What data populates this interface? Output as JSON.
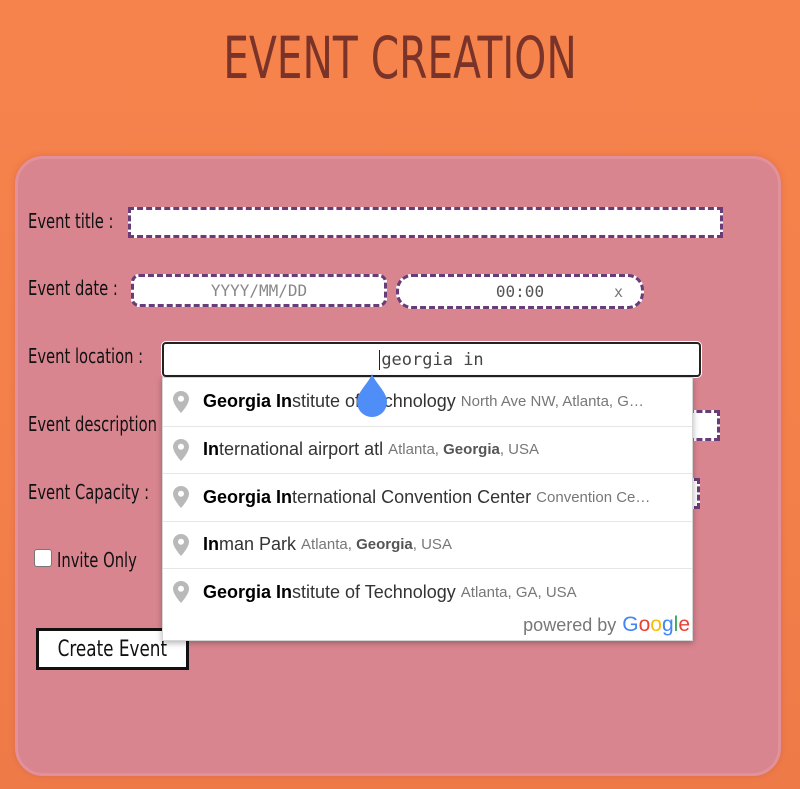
{
  "page": {
    "title": "EVENT CREATION"
  },
  "form": {
    "title_label": "Event title :",
    "title_value": "",
    "date_label": "Event date :",
    "date_placeholder": "YYYY/MM/DD",
    "time_value": "00:00",
    "time_clear": "x",
    "location_label": "Event location :",
    "location_value": "georgia in",
    "description_label": "Event description :",
    "capacity_label": "Event Capacity :",
    "invite_only_label": "Invite Only",
    "invite_only_checked": false,
    "create_button": "Create Event"
  },
  "autocomplete": {
    "items": [
      {
        "main_bold": "Georgia In",
        "main_rest": "stitute of Technology",
        "secondary": "North Ave NW, Atlanta, G…"
      },
      {
        "main_bold": "In",
        "main_rest": "ternational airport atl",
        "secondary_pre": "Atlanta, ",
        "secondary_bold": "Georgia",
        "secondary_post": ", USA"
      },
      {
        "main_bold": "Georgia In",
        "main_rest": "ternational Convention Center",
        "secondary": "Convention Ce…"
      },
      {
        "main_bold": "In",
        "main_rest": "man Park",
        "secondary_pre": "Atlanta, ",
        "secondary_bold": "Georgia",
        "secondary_post": ", USA"
      },
      {
        "main_bold": "Georgia In",
        "main_rest": "stitute of Technology",
        "secondary": "Atlanta, GA, USA"
      }
    ],
    "powered_by": "powered by",
    "google_letters": [
      "G",
      "o",
      "o",
      "g",
      "l",
      "e"
    ],
    "google_colors": [
      "#4285f4",
      "#ea4335",
      "#fbbc05",
      "#4285f4",
      "#34a853",
      "#ea4335"
    ]
  },
  "colors": {
    "background": "#f37f4a",
    "card": "#d88590",
    "title": "#7a3328",
    "field_border": "#6a3c77",
    "cursor_drop": "#4f8ef7"
  }
}
